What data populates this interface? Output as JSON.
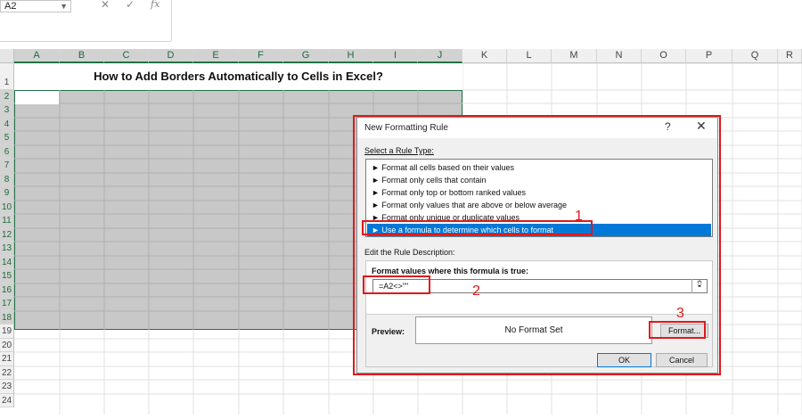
{
  "formula_bar": {
    "name_box": "A2",
    "cancel_icon": "✕",
    "enter_icon": "✓",
    "function_icon": "fx"
  },
  "sheet": {
    "columns": [
      "A",
      "B",
      "C",
      "D",
      "E",
      "F",
      "G",
      "H",
      "I",
      "J",
      "K",
      "L",
      "M",
      "N",
      "O",
      "P",
      "Q",
      "R"
    ],
    "rows": [
      "1",
      "2",
      "3",
      "4",
      "5",
      "6",
      "7",
      "8",
      "9",
      "10",
      "11",
      "12",
      "13",
      "14",
      "15",
      "16",
      "17",
      "18",
      "19",
      "20",
      "21",
      "22",
      "23",
      "24"
    ],
    "title": "How to Add Borders Automatically to Cells in Excel?"
  },
  "dialog": {
    "title": "New Formatting Rule",
    "help": "?",
    "close": "✕",
    "select_rule_label": "Select a Rule Type:",
    "rule_types": [
      "► Format all cells based on their values",
      "► Format only cells that contain",
      "► Format only top or bottom ranked values",
      "► Format only values that are above or below average",
      "► Format only unique or duplicate values",
      "► Use a formula to determine which cells to format"
    ],
    "edit_label": "Edit the Rule Description:",
    "formula_label": "Format values where this formula is true:",
    "formula_value": "=A2<>\"\"",
    "collapse_icon": "⮸",
    "preview_label": "Preview:",
    "preview_text": "No Format Set",
    "format_button": "Format...",
    "ok_button": "OK",
    "cancel_button": "Cancel"
  },
  "annotations": {
    "one": "1",
    "two": "2",
    "three": "3"
  },
  "colors": {
    "excel_green": "#217346",
    "annotation_red": "#e0191b",
    "selection_blue": "#0078d7"
  }
}
